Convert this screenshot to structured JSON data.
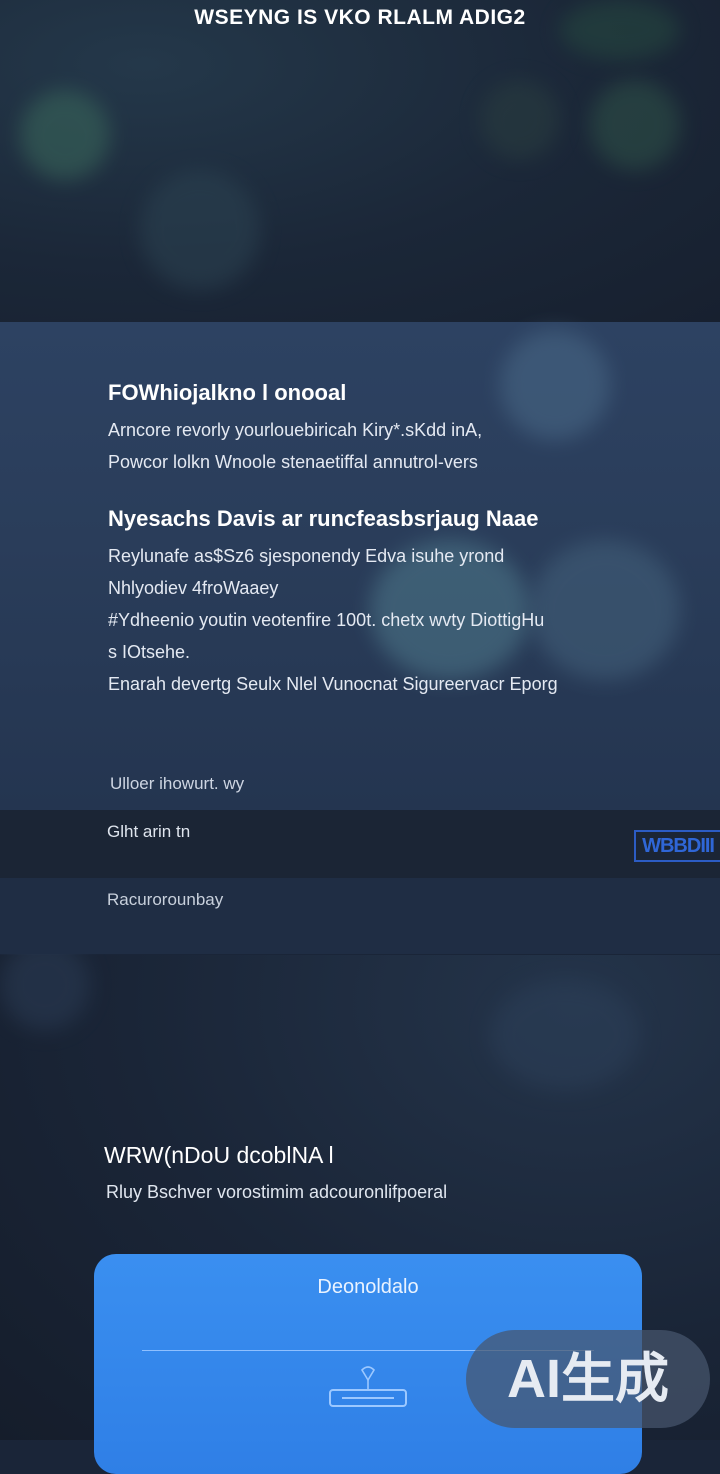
{
  "header": {
    "title": "WSEYNG IS VKO RLALM ADIG2"
  },
  "content": {
    "section1": {
      "heading": "FOWhiojalkno l onooal",
      "lines": [
        "Arncore revorly yourlouebiricah Kiry*.sKdd inA,",
        "Powcor lolkn Wnoole stenaetiffal annutrol-vers"
      ]
    },
    "section2": {
      "heading": "Nyesachs Davis  ar runcfeasbsrjaug Naae",
      "lines": [
        "Reylunafe as$Sz6 sjesponendy Edva isuhe yrond",
        "Nhlyodiev 4froWaaey",
        "#Ydheenio youtin veotenfire 100t. chetx wvty DiottigHu",
        "s IOtsehe.",
        "Enarah  devertg  Seulx  Nlel Vunocnat Sigureervacr Eporg"
      ]
    },
    "note": "Ulloer ihowurt.  wy"
  },
  "rows": {
    "row1_label": "Glht arin tn",
    "row1_tag": "WBBDIII",
    "row2_label": "Racurorounbay"
  },
  "bottom": {
    "title": "WRW(nDoU dcoblNA l",
    "subtitle": "Rluy Bschver vorostimim adcouronlifpoeral"
  },
  "card": {
    "title": "Deonoldalo"
  },
  "watermark": {
    "text": "AI生成"
  },
  "colors": {
    "accent": "#2f7fe6",
    "tag": "#2f66d6"
  },
  "icons": [
    "download-icon"
  ]
}
